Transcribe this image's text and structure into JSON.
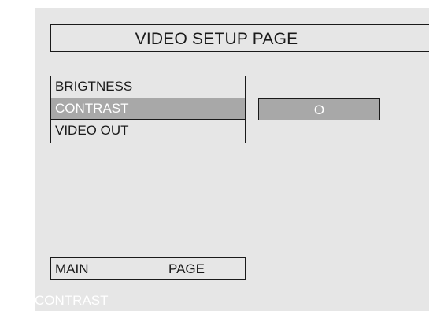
{
  "page": {
    "title": "VIDEO SETUP PAGE"
  },
  "menu": {
    "items": [
      {
        "label": "BRIGTNESS",
        "selected": false
      },
      {
        "label": "CONTRAST",
        "selected": true
      },
      {
        "label": "VIDEO OUT",
        "selected": false
      }
    ]
  },
  "value_display": {
    "value": "O"
  },
  "footer": {
    "left_label": "MAIN",
    "right_label": "PAGE"
  },
  "status": {
    "text": "CONTRAST"
  },
  "colors": {
    "background": "#e6e6e6",
    "highlight": "#a8a8a8",
    "border": "#1a1a1a",
    "highlight_text": "#ffffff"
  }
}
